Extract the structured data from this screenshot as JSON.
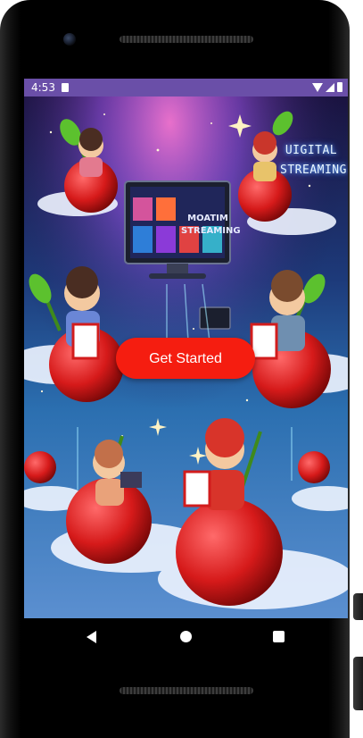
{
  "status_bar": {
    "time": "4:53"
  },
  "hero": {
    "logo_line1": "UIGITAL",
    "logo_line2": "STREAMING",
    "tv_line1": "MOATIM",
    "tv_line2": "STREAMING"
  },
  "cta": {
    "label": "Get Started",
    "color": "#f51d10"
  },
  "colors": {
    "status_bar": "#6a4fa8",
    "screen_bg": "#0d1330"
  },
  "icons": {
    "status": [
      "sd-card-icon",
      "wifi-icon",
      "signal-icon",
      "battery-icon"
    ],
    "navigation": [
      "back-icon",
      "home-icon",
      "recent-apps-icon"
    ]
  }
}
